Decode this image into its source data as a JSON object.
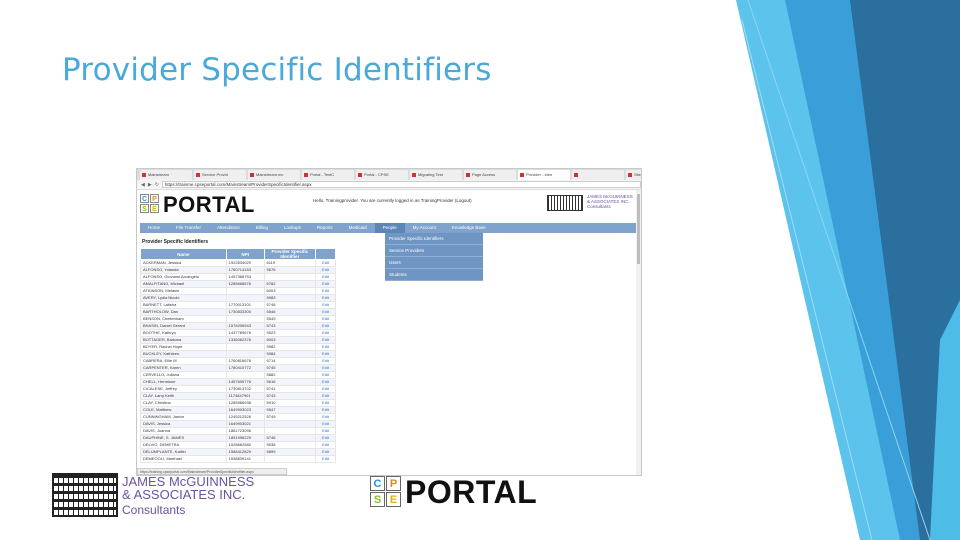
{
  "slide": {
    "title": "Provider Specific Identifiers"
  },
  "browser": {
    "tabs": [
      "Mainstream",
      "Service Provid",
      "Mainstream.mc",
      "Portal - TestC",
      "Portal - CPSE",
      "Migrating Test",
      "Page Access",
      "Provider - Iden",
      "",
      "Site Reports"
    ],
    "active_tab_index": 7,
    "url": "https://trainme.cpseportal.com/Mainstream/ProviderSpecificIdentifier.aspx",
    "status_url": "https://training.cpseportal.com/Mainstream/ProviderSpecificIdentifier.aspx"
  },
  "portal": {
    "logo_letters": [
      "C",
      "P",
      "S",
      "E"
    ],
    "logo_word": "PORTAL",
    "welcome": "Hello, Trainingprovider. You are currently logged in as TrainingProvider (Logout)",
    "company_small": [
      "JAMES McGUINNESS",
      "& ASSOCIATES INC.",
      "Consultants"
    ]
  },
  "menu": {
    "items": [
      "Home",
      "File Transfer",
      "Attendance",
      "Billing",
      "Lookups",
      "Reports",
      "Medicaid",
      "People",
      "My Account",
      "Knowledge Base"
    ],
    "active": "People"
  },
  "dropdown": {
    "items": [
      "Provider Specific Identifiers",
      "Service Providers",
      "Users",
      "Students"
    ]
  },
  "page": {
    "heading": "Provider Specific Identifiers",
    "columns": [
      "Name",
      "NPI",
      "Provider Specific Identifier",
      ""
    ],
    "rows": [
      [
        "ACKERMAN, Jessica",
        "1922634029",
        "6119",
        "Edit"
      ],
      [
        "ALFONSO, Yolanda",
        "1760714153",
        "5676",
        "Edit"
      ],
      [
        "ALFONSO, Giovanni Arcangelo",
        "1457368753",
        "",
        "Edit"
      ],
      [
        "AMALFITANO, Michael",
        "1285668576",
        "5782",
        "Edit"
      ],
      [
        "ATKINSON, Melanie",
        "",
        "6003",
        "Edit"
      ],
      [
        "AVERY, Lydia Nicole",
        "",
        "5983",
        "Edit"
      ],
      [
        "BARNETT, Latisha",
        "1770013101",
        "5748",
        "Edit"
      ],
      [
        "BARTHOLOW, Dan",
        "1730833300",
        "5546",
        "Edit"
      ],
      [
        "BENSON, Cheltenham",
        "",
        "5549",
        "Edit"
      ],
      [
        "BHASIN, Daniel Gerard",
        "1578206943",
        "5743",
        "Edit"
      ],
      [
        "BOOTHE, Kathryn",
        "1437789678",
        "5523",
        "Edit"
      ],
      [
        "BOTTAGER, Barbara",
        "1336062376",
        "6003",
        "Edit"
      ],
      [
        "BOYER, Rachel Hope",
        "",
        "5982",
        "Edit"
      ],
      [
        "BUCKLEY, Kathleen",
        "",
        "5984",
        "Edit"
      ],
      [
        "CABRERA, Ellie M",
        "1760816678",
        "5714",
        "Edit"
      ],
      [
        "CARPENTER, Karen",
        "1780410772",
        "5745",
        "Edit"
      ],
      [
        "CERVELLO, Juliana",
        "",
        "5882",
        "Edit"
      ],
      [
        "CHELL, Hermione",
        "1457695778",
        "5616",
        "Edit"
      ],
      [
        "CICALESE, Jeffrey",
        "1730813702",
        "5741",
        "Edit"
      ],
      [
        "CLAY, Larry Keith",
        "1174847901",
        "5743",
        "Edit"
      ],
      [
        "CLAY, Christina",
        "1285966938",
        "5910",
        "Edit"
      ],
      [
        "COLE, Matthew",
        "1649903023",
        "5547",
        "Edit"
      ],
      [
        "CUNNINGHAM, Janice",
        "1245212526",
        "5749",
        "Edit"
      ],
      [
        "DAVIS, Jessica",
        "1649903021",
        "",
        "Edit"
      ],
      [
        "DAVIS, Joanna",
        "1881723096",
        "",
        "Edit"
      ],
      [
        "DAUPHINE, S. JAMES",
        "1851596229",
        "5746",
        "Edit"
      ],
      [
        "DELVIO, DEMETRA",
        "1528682580",
        "5538",
        "Edit"
      ],
      [
        "DELUMPLANTE, Kaitlin",
        "1588412829",
        "5899",
        "Edit"
      ],
      [
        "DEMEOOLI, Marthael",
        "1538839141",
        "",
        "Edit"
      ]
    ]
  },
  "footer_logos": {
    "company": [
      "JAMES McGUINNESS",
      "& ASSOCIATES INC.",
      "Consultants"
    ],
    "portal_letters": [
      "C",
      "P",
      "S",
      "E"
    ],
    "portal_word": "PORTAL"
  },
  "colors": {
    "title": "#4aa9d8",
    "menu": "#7fa3cc",
    "dropdown": "#6f95c3",
    "logo_text": "#6b52a3",
    "facet_dark": "#1f5f8b",
    "facet_mid": "#2f86c4",
    "facet_light": "#5cc3ec"
  }
}
